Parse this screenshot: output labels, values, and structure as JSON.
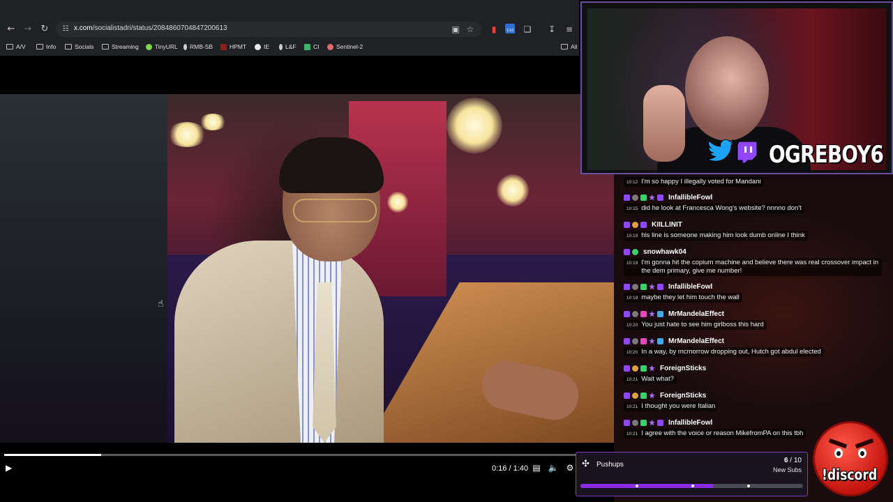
{
  "browser": {
    "url_host": "x.com",
    "url_path": "/socialistadri/status/2084860704847200613",
    "nav": {
      "back_icon": "arrow-left-icon",
      "forward_icon": "arrow-right-icon",
      "reload_icon": "reload-icon",
      "site_info_icon": "tune-icon"
    },
    "toolbar_icons": [
      "install-icon",
      "star-icon",
      "extension-red-icon",
      "extension-counter-icon",
      "puzzle-icon",
      "download-icon",
      "menu-icon"
    ],
    "extension_count": "110",
    "bookmarks": [
      {
        "label": "A/V",
        "icon": "folder-icon"
      },
      {
        "label": "Info",
        "icon": "folder-icon"
      },
      {
        "label": "Socials",
        "icon": "folder-icon"
      },
      {
        "label": "Streaming",
        "icon": "folder-icon"
      },
      {
        "label": "TinyURL",
        "icon": "tinyurl-icon"
      },
      {
        "label": "RMB-SB",
        "icon": "pin-icon"
      },
      {
        "label": "HPMT",
        "icon": "hpmt-icon"
      },
      {
        "label": "IE",
        "icon": "skull-icon"
      },
      {
        "label": "L&F",
        "icon": "pin-icon"
      },
      {
        "label": "CI",
        "icon": "ci-icon"
      },
      {
        "label": "Sentinel-2",
        "icon": "sentinel-icon"
      },
      {
        "label": "All",
        "icon": "folder-icon"
      }
    ]
  },
  "video": {
    "current_time": "0:16",
    "duration": "1:40",
    "time_display": "0:16 / 1:40",
    "progress_fraction": 0.16,
    "play_icon": "play-icon",
    "captions_icon": "captions-icon",
    "volume_icon": "volume-icon",
    "settings_icon": "settings-icon"
  },
  "chat": {
    "messages": [
      {
        "username": "",
        "time": "10:12",
        "text": "I'm so happy I illegally voted for Mandani",
        "badges": []
      },
      {
        "username": "InfallibleFowl",
        "time": "10:15",
        "text": "did he look at Francesca Wong's website? nnnno don't",
        "badges": [
          "b-sub",
          "b-grey",
          "b-green",
          "b-star",
          "b-sub"
        ]
      },
      {
        "username": "KIILLINIT",
        "time": "10:19",
        "text": "his line is someone making him look dumb online I think",
        "badges": [
          "b-sub",
          "b-face",
          "b-sub"
        ]
      },
      {
        "username": "snowhawk04",
        "time": "10:19",
        "text": "I'm gonna hit the copium machine and believe there was real crossover impact in the dem primary, give me number!",
        "badges": [
          "b-sub",
          "b-green"
        ]
      },
      {
        "username": "InfallibleFowl",
        "time": "10:19",
        "text": "maybe they let him touch the wall",
        "badges": [
          "b-sub",
          "b-grey",
          "b-green",
          "b-star",
          "b-sub"
        ]
      },
      {
        "username": "MrMandelaEffect",
        "time": "10:20",
        "text": "You just hate to see him girlboss this hard",
        "badges": [
          "b-sub",
          "b-grey",
          "b-pink",
          "b-star",
          "b-blue"
        ]
      },
      {
        "username": "MrMandelaEffect",
        "time": "10:20",
        "text": "In a way, by mcmorrow dropping out, Hutch got abdul elected",
        "badges": [
          "b-sub",
          "b-grey",
          "b-pink",
          "b-star",
          "b-blue"
        ]
      },
      {
        "username": "ForeignSticks",
        "time": "10:21",
        "text": "Wait what?",
        "badges": [
          "b-sub",
          "b-face",
          "b-green",
          "b-star"
        ]
      },
      {
        "username": "ForeignSticks",
        "time": "10:21",
        "text": "I thought you were Italian",
        "badges": [
          "b-sub",
          "b-face",
          "b-green",
          "b-star"
        ]
      },
      {
        "username": "InfallibleFowl",
        "time": "10:21",
        "text": "I agree with the voice or reason MikefromPA on this tbh",
        "badges": [
          "b-sub",
          "b-grey",
          "b-green",
          "b-star",
          "b-sub"
        ]
      }
    ]
  },
  "webcam": {
    "brand": "OGREBOY6",
    "twitter_icon": "twitter-icon",
    "twitch_icon": "twitch-icon"
  },
  "pushups": {
    "title": "Pushups",
    "current": "6",
    "separator": " / ",
    "goal": "10",
    "subtitle": "New Subs",
    "progress_fraction": 0.6,
    "icon": "pushups-icon",
    "accent": "#8a2be2"
  },
  "discord": {
    "label": "!discord",
    "icon": "angry-face-icon"
  }
}
